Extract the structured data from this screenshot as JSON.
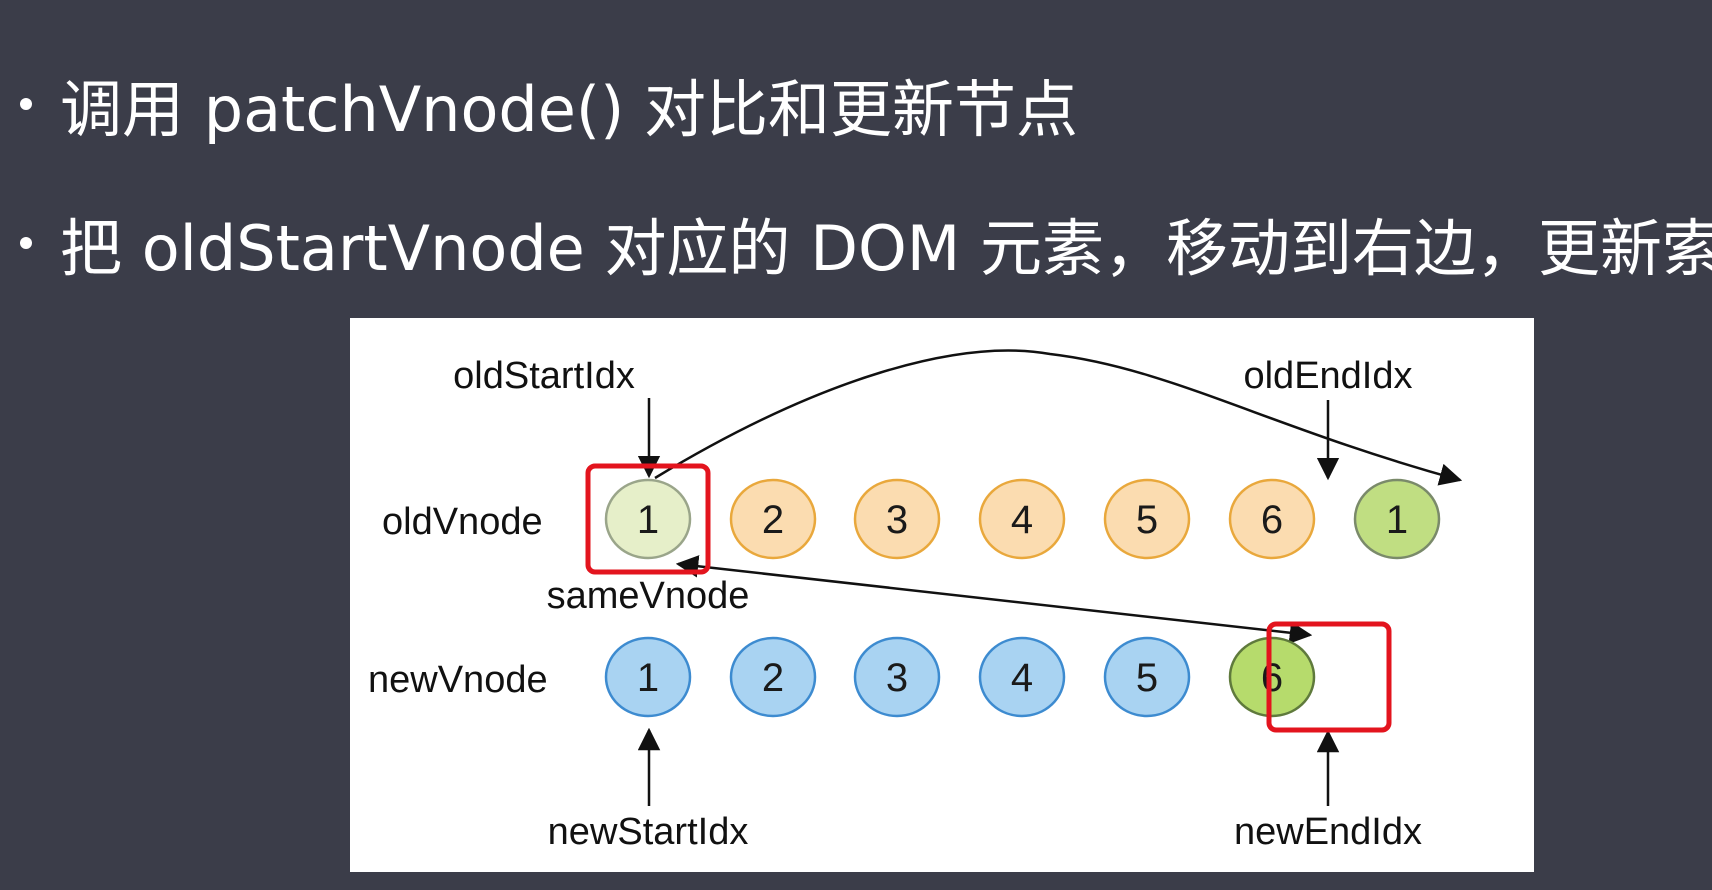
{
  "bullets": [
    {
      "text": "调用 patchVnode() 对比和更新节点"
    },
    {
      "text": "把 oldStartVnode 对应的 DOM 元素，移动到右边，更新索引"
    }
  ],
  "diagram": {
    "labels": {
      "old_start_idx": "oldStartIdx",
      "old_end_idx": "oldEndIdx",
      "new_start_idx": "newStartIdx",
      "new_end_idx": "newEndIdx",
      "old_vnode": "oldVnode",
      "new_vnode": "newVnode",
      "same_vnode": "sameVnode"
    },
    "old_nodes": [
      "1",
      "2",
      "3",
      "4",
      "5",
      "6",
      "1"
    ],
    "new_nodes": [
      "1",
      "2",
      "3",
      "4",
      "5",
      "6"
    ],
    "colors": {
      "old_node_fill": "#fbdcb0",
      "old_node_stroke": "#e9a83c",
      "old_start_fill": "#e6efc9",
      "old_start_stroke": "#9aa58a",
      "moved_fill": "#c0de82",
      "moved_stroke": "#7a8a6a",
      "new_node_fill": "#a9d3f2",
      "new_node_stroke": "#3d8bd0",
      "new_end_fill": "#b6db6c",
      "new_end_stroke": "#5f7a3c",
      "highlight_box": "#e3141e"
    }
  }
}
